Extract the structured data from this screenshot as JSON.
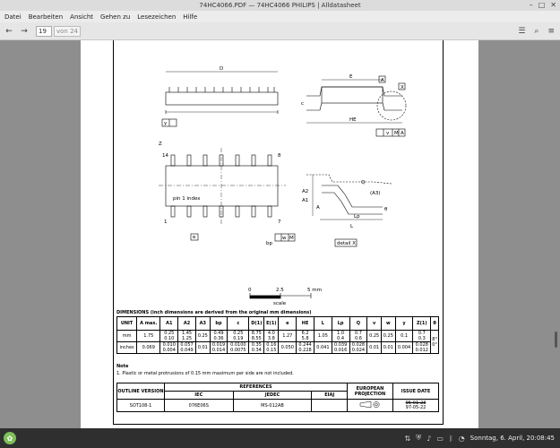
{
  "window": {
    "title": "74HC4066.PDF — 74HC4066 PHILIPS | Alldatasheet"
  },
  "menu": [
    "Datei",
    "Bearbeiten",
    "Ansicht",
    "Gehen zu",
    "Lesezeichen",
    "Hilfe"
  ],
  "toolbar": {
    "page_value": "19",
    "page_of": "von 24"
  },
  "drawing": {
    "top_labels": {
      "D": "D",
      "E": "E",
      "A": "A",
      "X": "X",
      "c": "c",
      "y": "y",
      "HE": "HE",
      "v": "v",
      "M": "M",
      "A2": "A"
    },
    "side_labels": {
      "Z": "Z",
      "pin14": "14",
      "pin8": "8",
      "pin1": "1",
      "pin7": "7",
      "pin1index": "pin 1 index",
      "e": "e",
      "bp": "bp",
      "w": "w",
      "M": "M"
    },
    "detail_labels": {
      "A2": "A2",
      "A1": "A1",
      "A": "A",
      "Q": "Q",
      "A3": "(A3)",
      "theta": "θ",
      "Lp": "Lp",
      "L": "L",
      "detail": "detail X"
    },
    "scale": {
      "t0": "0",
      "t1": "2.5",
      "t2": "5 mm",
      "caption": "scale"
    }
  },
  "dimensions": {
    "title": "DIMENSIONS (inch dimensions are derived from the original mm dimensions)",
    "headers": [
      "UNIT",
      "A max.",
      "A1",
      "A2",
      "A3",
      "bp",
      "c",
      "D(1)",
      "E(1)",
      "e",
      "HE",
      "L",
      "Lp",
      "Q",
      "v",
      "w",
      "y",
      "Z(1)",
      "θ"
    ],
    "rows": [
      [
        "mm",
        "1.75",
        "0.25\n0.10",
        "1.45\n1.25",
        "0.25",
        "0.49\n0.36",
        "0.25\n0.19",
        "8.75\n8.55",
        "4.0\n3.8",
        "1.27",
        "6.2\n5.8",
        "1.05",
        "1.0\n0.4",
        "0.7\n0.6",
        "0.25",
        "0.25",
        "0.1",
        "0.7\n0.3",
        "8°\n0°"
      ],
      [
        "inches",
        "0.069",
        "0.010\n0.004",
        "0.057\n0.049",
        "0.01",
        "0.019\n0.014",
        "0.0100\n0.0075",
        "0.35\n0.34",
        "0.16\n0.15",
        "0.050",
        "0.244\n0.228",
        "0.041",
        "0.039\n0.016",
        "0.028\n0.024",
        "0.01",
        "0.01",
        "0.004",
        "0.028\n0.012",
        ""
      ]
    ]
  },
  "note": {
    "title": "Note",
    "text": "1. Plastic or metal protrusions of 0.15 mm maximum per side are not included."
  },
  "outline": {
    "headers": {
      "version": "OUTLINE VERSION",
      "references": "REFERENCES",
      "iec": "IEC",
      "jedec": "JEDEC",
      "eiaj": "EIAJ",
      "projection": "EUROPEAN PROJECTION",
      "issue": "ISSUE DATE"
    },
    "row": {
      "version": "SOT108-1",
      "iec": "076E06S",
      "jedec": "MS-012AB",
      "eiaj": "",
      "issue_old": "95-01-23",
      "issue_new": "97-05-22"
    }
  },
  "taskbar": {
    "clock": "Sonntag, 6. April, 20:08:45"
  },
  "colors": {
    "taskbar": "#2f2f2f",
    "start": "#7fbf5b",
    "viewer_bg": "#8e8e8e"
  }
}
